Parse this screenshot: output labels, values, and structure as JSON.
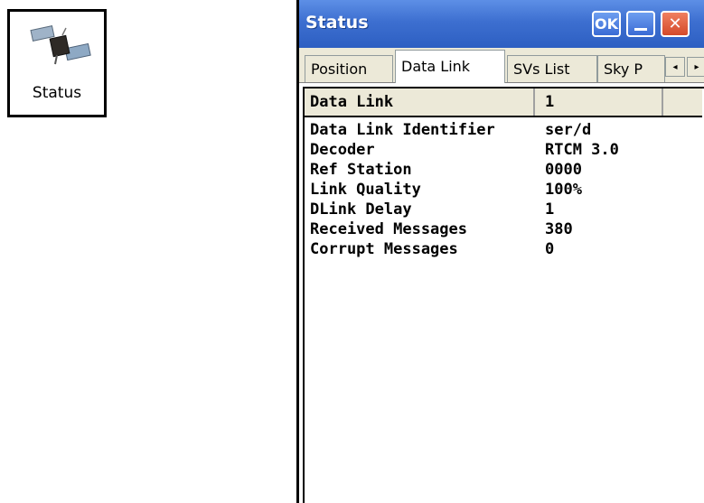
{
  "desktop_icon": {
    "label": "Status",
    "icon": "satellite-icon"
  },
  "window": {
    "title": "Status",
    "buttons": {
      "ok": "OK",
      "minimize": "minimize",
      "close": "✕"
    }
  },
  "tabs": [
    {
      "label": "Position",
      "active": false
    },
    {
      "label": "Data Link",
      "active": true
    },
    {
      "label": "SVs List",
      "active": false
    },
    {
      "label": "Sky P",
      "active": false
    }
  ],
  "tab_scroll": {
    "left": "◂",
    "right": "▸"
  },
  "table": {
    "header": {
      "col1": "Data Link",
      "col2": "1"
    },
    "rows": [
      {
        "key": "Data Link Identifier",
        "value": "ser/d"
      },
      {
        "key": "Decoder",
        "value": "RTCM 3.0"
      },
      {
        "key": "Ref Station",
        "value": "0000"
      },
      {
        "key": "Link Quality",
        "value": "100%"
      },
      {
        "key": "DLink Delay",
        "value": "1"
      },
      {
        "key": "Received Messages",
        "value": "380"
      },
      {
        "key": "Corrupt Messages",
        "value": "0"
      }
    ]
  },
  "colors": {
    "titlebar": "#3d6fd0",
    "close_button": "#d44a2a",
    "tab_bg": "#ece9d8"
  }
}
